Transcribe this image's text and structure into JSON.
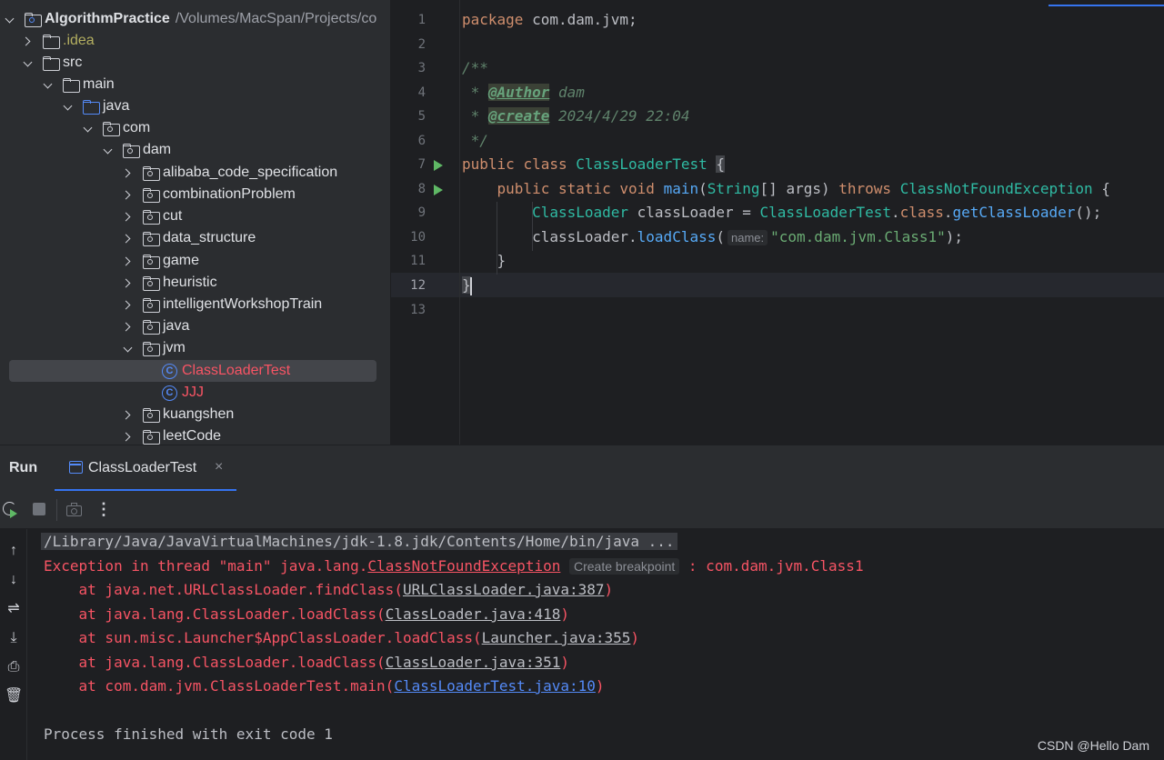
{
  "project_tree": {
    "root": {
      "name": "AlgorithmPractice",
      "path": "/Volumes/MacSpan/Projects/co"
    },
    "items": [
      {
        "label": ".idea"
      },
      {
        "label": "src"
      },
      {
        "label": "main"
      },
      {
        "label": "java"
      },
      {
        "label": "com"
      },
      {
        "label": "dam"
      },
      {
        "label": "alibaba_code_specification"
      },
      {
        "label": "combinationProblem"
      },
      {
        "label": "cut"
      },
      {
        "label": "data_structure"
      },
      {
        "label": "game"
      },
      {
        "label": "heuristic"
      },
      {
        "label": "intelligentWorkshopTrain"
      },
      {
        "label": "java"
      },
      {
        "label": "jvm"
      },
      {
        "label": "ClassLoaderTest"
      },
      {
        "label": "JJJ"
      },
      {
        "label": "kuangshen"
      },
      {
        "label": "leetCode"
      }
    ],
    "class_icon_letter": "C"
  },
  "editor": {
    "line_numbers": [
      "1",
      "2",
      "3",
      "4",
      "5",
      "6",
      "7",
      "8",
      "9",
      "10",
      "11",
      "12",
      "13"
    ],
    "tokens": {
      "package_kw": "package",
      "package_name": "com.dam.jvm;",
      "doc_open": "/**",
      "doc_star": " * ",
      "author_tag": "@Author",
      "author_val": " dam",
      "create_tag": "@create",
      "create_val": " 2024/4/29 22:04",
      "doc_close": " */",
      "public": "public",
      "class": "class",
      "class_name": "ClassLoaderTest",
      "open_brace": "{",
      "static": "static",
      "void": "void",
      "main": "main",
      "string_type": "String",
      "main_params": "[] args) ",
      "throws": "throws",
      "exception_type": "ClassNotFoundException",
      "classloader_type": "ClassLoader",
      "classloader_var": " classLoader = ",
      "class_ref": "ClassLoaderTest",
      "dot": ".",
      "class_kw": "class",
      "get_cl": "getClassLoader",
      "call_end": "();",
      "classloader_call": "classLoader.",
      "load_class": "loadClass",
      "paren_open": "(",
      "param_hint": "name:",
      "string_arg": "\"com.dam.jvm.Class1\"",
      "paren_close": ");",
      "close_brace": "}"
    }
  },
  "run_panel": {
    "title": "Run",
    "tab_label": "ClassLoaderTest",
    "tab_close": "×",
    "more_label": "⋮"
  },
  "console": {
    "command": "/Library/Java/JavaVirtualMachines/jdk-1.8.jdk/Contents/Home/bin/java ...",
    "exception_prefix": "Exception in thread \"main\" java.lang.",
    "exception_class": "ClassNotFoundException",
    "breakpoint_hint": "Create breakpoint",
    "exception_suffix": " : com.dam.jvm.Class1",
    "stack": [
      {
        "prefix": "    at java.net.URLClassLoader.findClass(",
        "link": "URLClassLoader.java:387",
        "suffix": ")"
      },
      {
        "prefix": "    at java.lang.ClassLoader.loadClass(",
        "link": "ClassLoader.java:418",
        "suffix": ")"
      },
      {
        "prefix": "    at sun.misc.Launcher$AppClassLoader.loadClass(",
        "link": "Launcher.java:355",
        "suffix": ")"
      },
      {
        "prefix": "    at java.lang.ClassLoader.loadClass(",
        "link": "ClassLoader.java:351",
        "suffix": ")"
      },
      {
        "prefix": "    at com.dam.jvm.ClassLoaderTest.main(",
        "link": "ClassLoaderTest.java:10",
        "suffix": ")"
      }
    ],
    "exit_message": "Process finished with exit code 1"
  },
  "watermark": "CSDN @Hello Dam",
  "colors": {
    "background": "#1e1f22",
    "panel": "#2b2d30",
    "keyword": "#cf8e6d",
    "type": "#2fbaa3",
    "string": "#6aab73",
    "error": "#f75464",
    "link_blue": "#548af7",
    "accent": "#3574f0"
  }
}
